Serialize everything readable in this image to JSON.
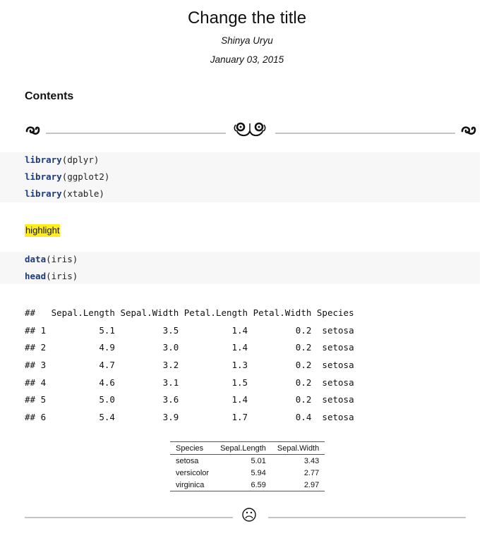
{
  "document": {
    "title": "Change the title",
    "author": "Shinya Uryu",
    "date": "January 03, 2015",
    "contents_heading": "Contents"
  },
  "code_block_1": {
    "lines": [
      {
        "fn": "library",
        "args": "(dplyr)"
      },
      {
        "fn": "library",
        "args": "(ggplot2)"
      },
      {
        "fn": "library",
        "args": "(xtable)"
      }
    ]
  },
  "highlight_text": "highlight",
  "code_block_2": {
    "lines": [
      {
        "fn": "data",
        "args": "(iris)"
      },
      {
        "fn": "head",
        "args": "(iris)"
      }
    ]
  },
  "console_output": {
    "header": "##   Sepal.Length Sepal.Width Petal.Length Petal.Width Species",
    "rows": [
      "## 1          5.1         3.5          1.4         0.2  setosa",
      "## 2          4.9         3.0          1.4         0.2  setosa",
      "## 3          4.7         3.2          1.3         0.2  setosa",
      "## 4          4.6         3.1          1.5         0.2  setosa",
      "## 5          5.0         3.6          1.4         0.2  setosa",
      "## 6          5.4         3.9          1.7         0.4  setosa"
    ]
  },
  "summary_table": {
    "headers": [
      "Species",
      "Sepal.Length",
      "Sepal.Width"
    ],
    "rows": [
      [
        "setosa",
        "5.01",
        "3.43"
      ],
      [
        "versicolor",
        "5.94",
        "2.77"
      ],
      [
        "virginica",
        "6.59",
        "2.97"
      ]
    ]
  },
  "ornaments": {
    "top_divider": "floral-ornament-icon",
    "bottom_divider": "sad-face-icon"
  },
  "colors": {
    "code_background": "#f7f7f7",
    "keyword": "#1c3a7a",
    "highlight": "#ffec1f"
  }
}
